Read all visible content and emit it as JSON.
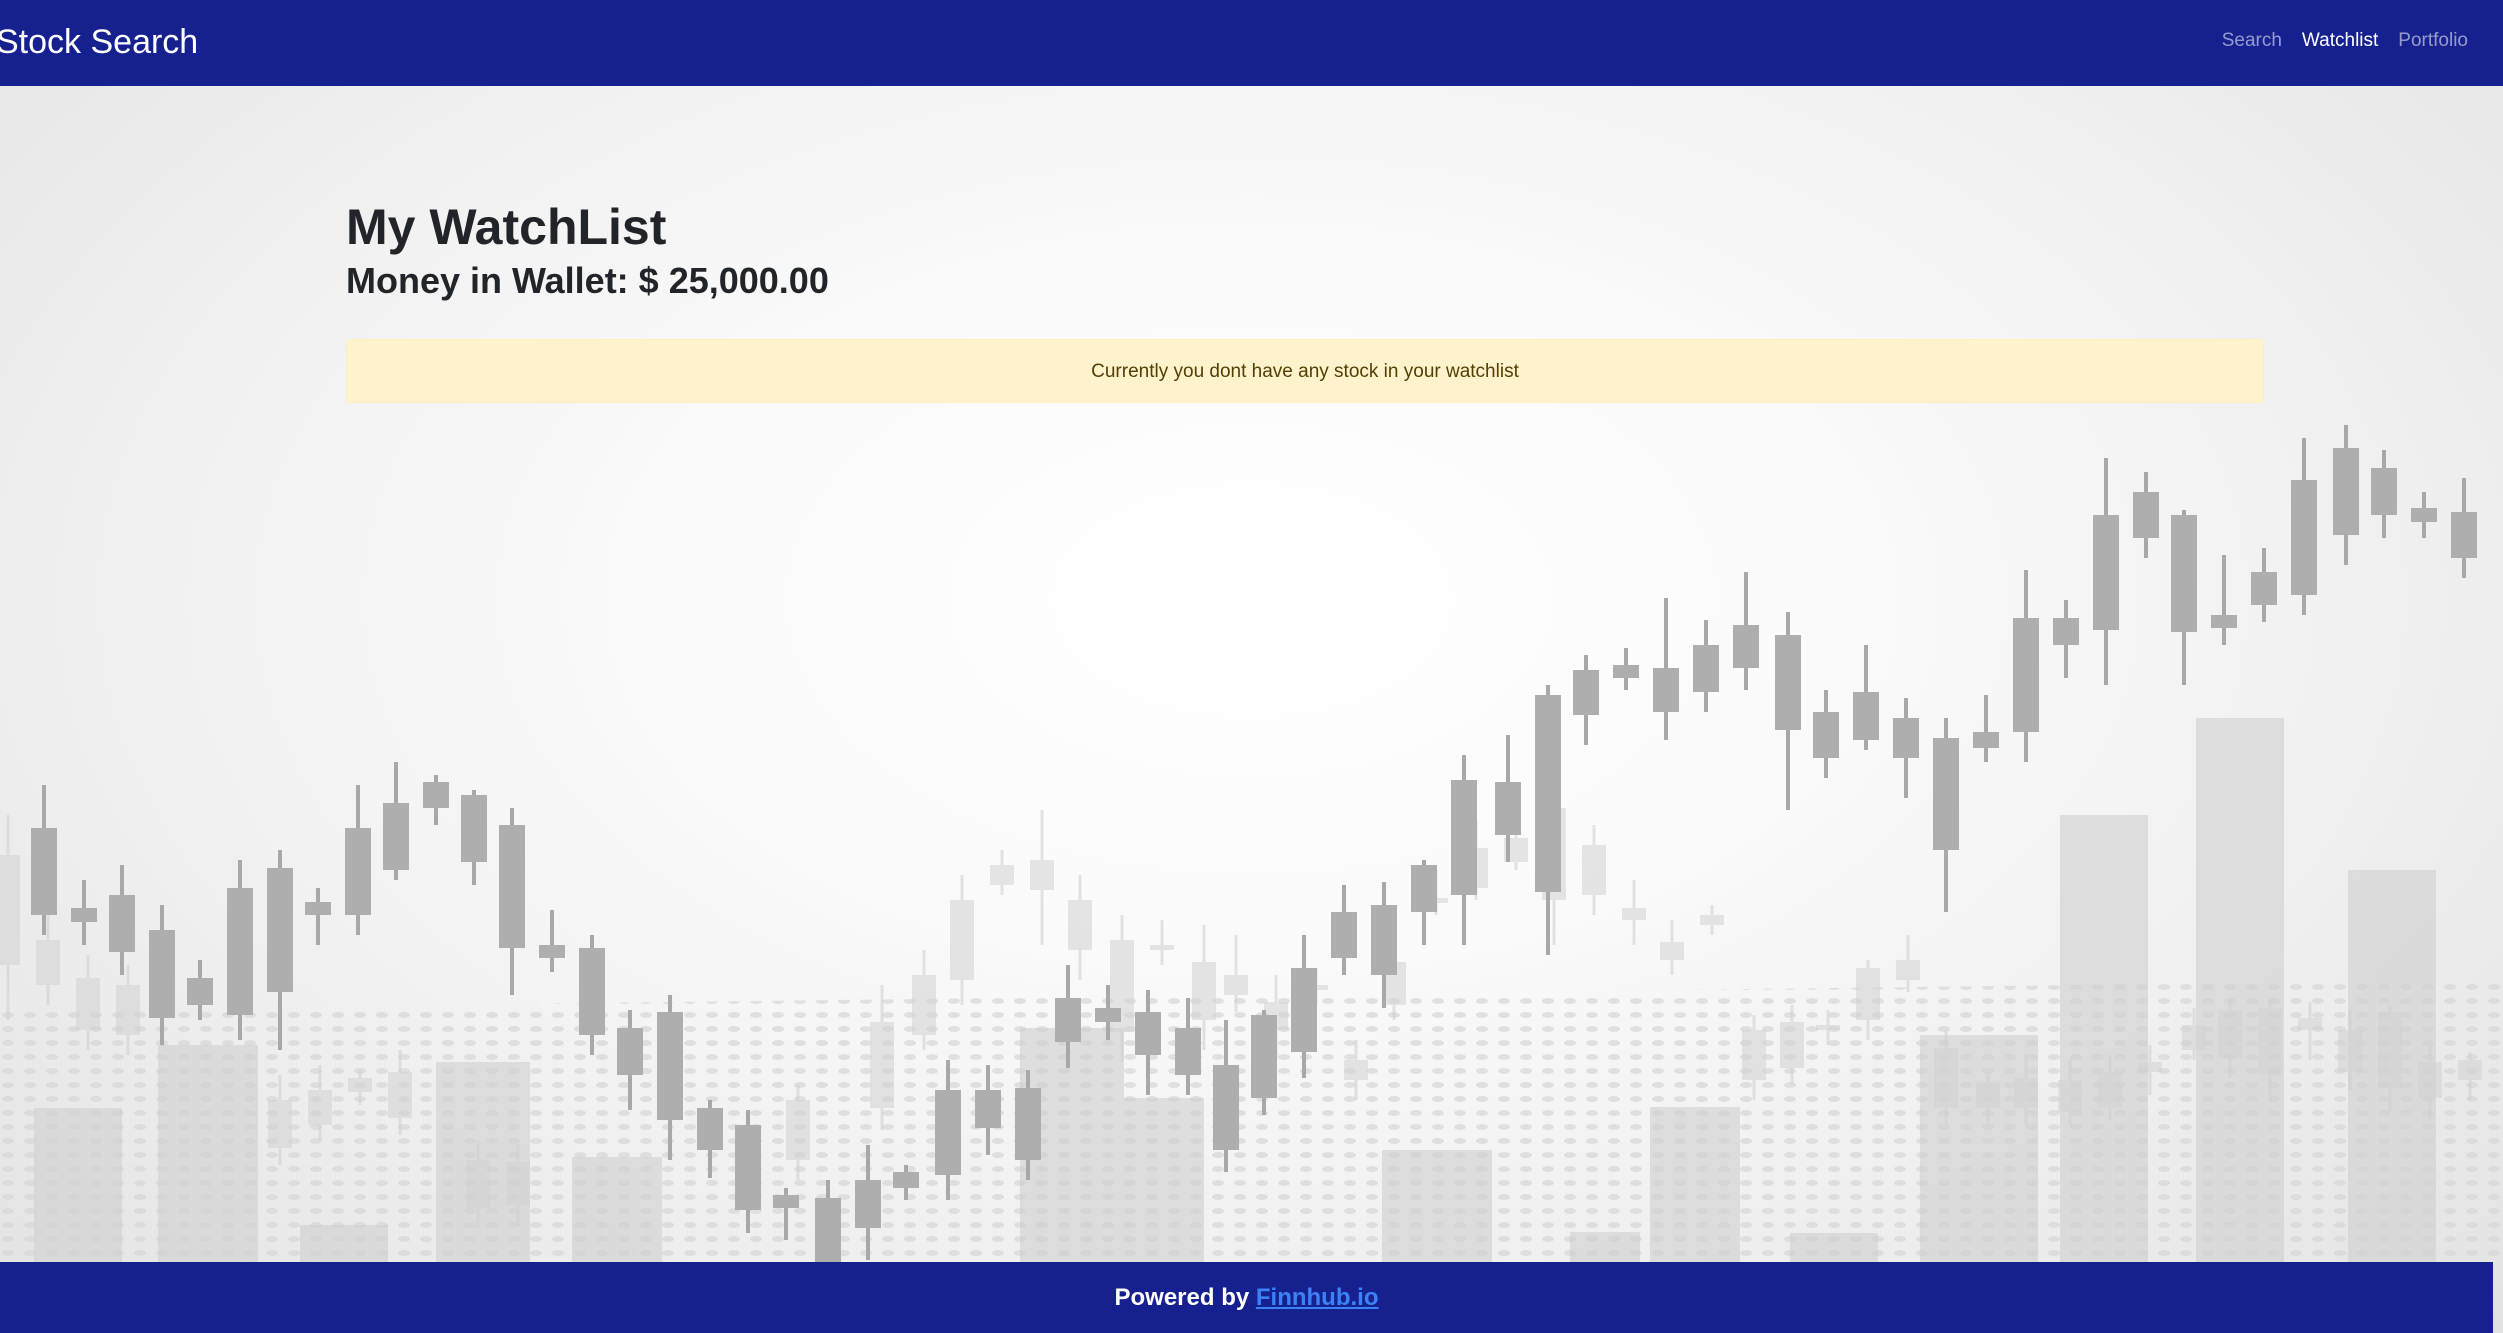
{
  "navbar": {
    "brand": "Stock Search",
    "links": [
      {
        "label": "Search",
        "active": false
      },
      {
        "label": "Watchlist",
        "active": true
      },
      {
        "label": "Portfolio",
        "active": false
      }
    ]
  },
  "main": {
    "title": "My WatchList",
    "wallet_label": "Money in Wallet: $ 25,000.00",
    "empty_message": "Currently you dont have any stock in your watchlist"
  },
  "footer": {
    "prefix": "Powered by ",
    "link_label": "Finnhub.io"
  },
  "colors": {
    "navbar": "#16218f",
    "alert_bg": "#fff3cd",
    "alert_text": "#533f03",
    "link": "#3b82f6"
  },
  "background": {
    "description_icon": "candlestick-chart-background"
  }
}
